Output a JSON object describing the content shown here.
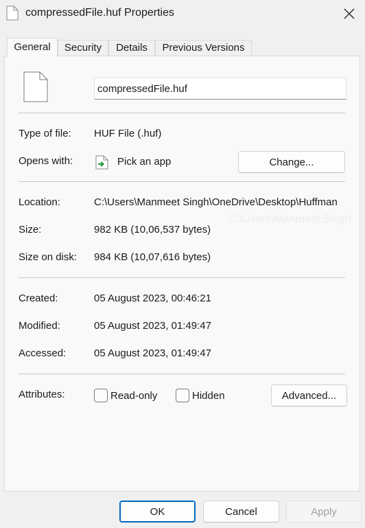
{
  "window": {
    "title": "compressedFile.huf Properties",
    "icon": "file-icon",
    "close_icon": "close-icon"
  },
  "tabs": [
    {
      "label": "General",
      "active": true
    },
    {
      "label": "Security",
      "active": false
    },
    {
      "label": "Details",
      "active": false
    },
    {
      "label": "Previous Versions",
      "active": false
    }
  ],
  "general": {
    "file_name": "compressedFile.huf",
    "type_label": "Type of file:",
    "type_value": "HUF File (.huf)",
    "opens_label": "Opens with:",
    "opens_value": "Pick an app",
    "change_button": "Change...",
    "location_label": "Location:",
    "location_value": "C:\\Users\\Manmeet Singh\\OneDrive\\Desktop\\Huffman",
    "location_ghost": "C:\\Users\\Manmeet Singh",
    "size_label": "Size:",
    "size_value": "982 KB (10,06,537 bytes)",
    "size_on_disk_label": "Size on disk:",
    "size_on_disk_value": "984 KB (10,07,616 bytes)",
    "created_label": "Created:",
    "created_value": "05 August 2023, 00:46:21",
    "modified_label": "Modified:",
    "modified_value": "05 August 2023, 01:49:47",
    "accessed_label": "Accessed:",
    "accessed_value": "05 August 2023, 01:49:47",
    "attributes_label": "Attributes:",
    "readonly_label": "Read-only",
    "readonly_checked": false,
    "hidden_label": "Hidden",
    "hidden_checked": false,
    "advanced_button": "Advanced..."
  },
  "footer": {
    "ok_label": "OK",
    "cancel_label": "Cancel",
    "apply_label": "Apply",
    "apply_enabled": false
  },
  "colors": {
    "accent": "#0067c0",
    "panel_bg": "#f9f9f9",
    "window_bg": "#f0f0f0"
  }
}
